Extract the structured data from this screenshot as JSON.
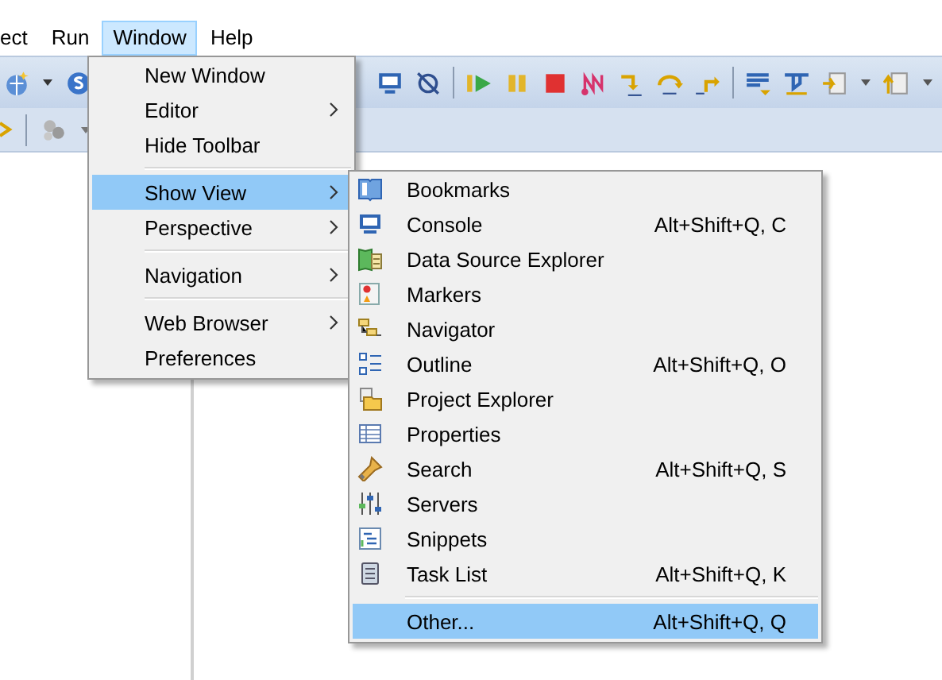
{
  "menubar": [
    {
      "label": "ect",
      "selected": false
    },
    {
      "label": "Run",
      "selected": false
    },
    {
      "label": "Window",
      "selected": true
    },
    {
      "label": "Help",
      "selected": false
    }
  ],
  "window_menu": {
    "items": [
      {
        "kind": "item",
        "label": "New Window",
        "submenu": false,
        "selected": false
      },
      {
        "kind": "item",
        "label": "Editor",
        "submenu": true,
        "selected": false
      },
      {
        "kind": "item",
        "label": "Hide Toolbar",
        "submenu": false,
        "selected": false
      },
      {
        "kind": "separator"
      },
      {
        "kind": "item",
        "label": "Show View",
        "submenu": true,
        "selected": true
      },
      {
        "kind": "item",
        "label": "Perspective",
        "submenu": true,
        "selected": false
      },
      {
        "kind": "separator"
      },
      {
        "kind": "item",
        "label": "Navigation",
        "submenu": true,
        "selected": false
      },
      {
        "kind": "separator"
      },
      {
        "kind": "item",
        "label": "Web Browser",
        "submenu": true,
        "selected": false
      },
      {
        "kind": "item",
        "label": "Preferences",
        "submenu": false,
        "selected": false
      }
    ]
  },
  "show_view_menu": {
    "items": [
      {
        "kind": "item",
        "label": "Bookmarks",
        "selected": false
      },
      {
        "kind": "item",
        "label": "Console",
        "shortcut": "Alt+Shift+Q, C",
        "selected": false
      },
      {
        "kind": "item",
        "label": "Data Source Explorer",
        "selected": false
      },
      {
        "kind": "item",
        "label": "Markers",
        "selected": false
      },
      {
        "kind": "item",
        "label": "Navigator",
        "selected": false
      },
      {
        "kind": "item",
        "label": "Outline",
        "shortcut": "Alt+Shift+Q, O",
        "selected": false
      },
      {
        "kind": "item",
        "label": "Project Explorer",
        "selected": false
      },
      {
        "kind": "item",
        "label": "Properties",
        "selected": false
      },
      {
        "kind": "item",
        "label": "Search",
        "shortcut": "Alt+Shift+Q, S",
        "selected": false
      },
      {
        "kind": "item",
        "label": "Servers",
        "selected": false
      },
      {
        "kind": "item",
        "label": "Snippets",
        "selected": false
      },
      {
        "kind": "item",
        "label": "Task List",
        "shortcut": "Alt+Shift+Q, K",
        "selected": false
      },
      {
        "kind": "separator"
      },
      {
        "kind": "item",
        "label": "Other...",
        "shortcut": "Alt+Shift+Q, Q",
        "selected": true
      }
    ]
  }
}
